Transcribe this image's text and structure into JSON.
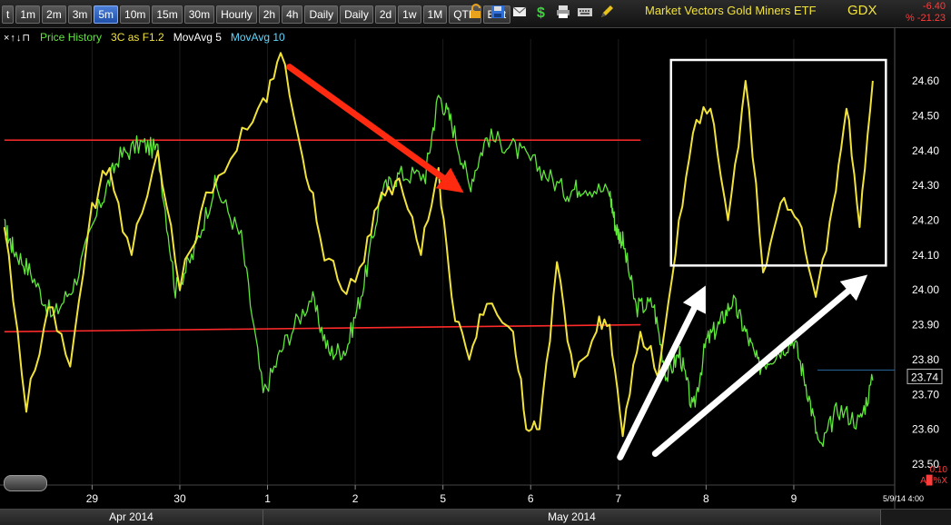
{
  "toolbar": {
    "timeframes": [
      "t",
      "1m",
      "2m",
      "3m",
      "5m",
      "10m",
      "15m",
      "30m",
      "Hourly",
      "2h",
      "4h",
      "Daily",
      "Daily",
      "2d",
      "1w",
      "1M",
      "QTR",
      "Edit"
    ],
    "active_index": 4,
    "security_name": "Market Vectors Gold Miners ETF",
    "symbol": "GDX",
    "change_abs": "-6.40",
    "change_pct": "% -21.23",
    "icons": [
      "lock-icon",
      "save-icon",
      "mail-icon",
      "dollar-icon",
      "print-icon",
      "keyboard-icon",
      "pencil-icon"
    ]
  },
  "legend": {
    "arrows": "×↑↓⊓",
    "price_history": "Price History",
    "indicator": "3C as F1.2",
    "ma5": "MovAvg 5",
    "ma10": "MovAvg 10"
  },
  "axis_corner": {
    "top": "0.10",
    "bottom": "A▉%X"
  },
  "last_date": "5/9/14 4:00",
  "months": [
    {
      "label": "Apr 2014"
    },
    {
      "label": "May 2014"
    }
  ],
  "colors": {
    "price": "#5fe83a",
    "indicator": "#f2e33b",
    "trendline": "#ff2a2a",
    "annot": "#ffffff",
    "arrow_red": "#ff2a10"
  },
  "chart_data": {
    "type": "line",
    "title": "",
    "xlabel": "",
    "ylabel": "",
    "ylim": [
      23.44,
      24.72
    ],
    "yticks": [
      24.6,
      24.5,
      24.4,
      24.3,
      24.2,
      24.1,
      24.0,
      23.9,
      23.8,
      23.7,
      23.6,
      23.5
    ],
    "ytick_labels": [
      "24.60",
      "24.50",
      "24.40",
      "24.30",
      "24.20",
      "24.10",
      "24.00",
      "23.90",
      "23.80",
      "23.70",
      "23.60",
      "23.50"
    ],
    "last_price": "23.74",
    "day_ticks": [
      {
        "label": "29",
        "i": 1.0
      },
      {
        "label": "30",
        "i": 2.0
      },
      {
        "label": "1",
        "i": 3.0
      },
      {
        "label": "2",
        "i": 4.0
      },
      {
        "label": "5",
        "i": 5.0
      },
      {
        "label": "6",
        "i": 6.0
      },
      {
        "label": "7",
        "i": 7.0
      },
      {
        "label": "8",
        "i": 8.0
      },
      {
        "label": "9",
        "i": 9.0
      }
    ],
    "series": [
      {
        "name": "Price History",
        "color": "green",
        "points": [
          [
            0.0,
            24.18
          ],
          [
            0.1,
            24.12
          ],
          [
            0.3,
            24.05
          ],
          [
            0.55,
            23.92
          ],
          [
            0.8,
            24.02
          ],
          [
            1.1,
            24.25
          ],
          [
            1.3,
            24.38
          ],
          [
            1.55,
            24.42
          ],
          [
            1.75,
            24.4
          ],
          [
            1.95,
            24.0
          ],
          [
            2.15,
            24.1
          ],
          [
            2.4,
            24.3
          ],
          [
            2.7,
            24.15
          ],
          [
            2.95,
            23.7
          ],
          [
            3.2,
            23.85
          ],
          [
            3.5,
            23.98
          ],
          [
            3.7,
            23.82
          ],
          [
            3.9,
            23.83
          ],
          [
            4.1,
            24.02
          ],
          [
            4.3,
            24.28
          ],
          [
            4.5,
            24.33
          ],
          [
            4.8,
            24.33
          ],
          [
            4.95,
            24.56
          ],
          [
            5.1,
            24.48
          ],
          [
            5.3,
            24.3
          ],
          [
            5.5,
            24.44
          ],
          [
            5.8,
            24.41
          ],
          [
            6.1,
            24.35
          ],
          [
            6.4,
            24.28
          ],
          [
            6.6,
            24.3
          ],
          [
            6.9,
            24.28
          ],
          [
            6.97,
            24.18
          ],
          [
            7.05,
            24.14
          ],
          [
            7.2,
            23.95
          ],
          [
            7.4,
            23.96
          ],
          [
            7.55,
            23.75
          ],
          [
            7.7,
            23.82
          ],
          [
            7.85,
            23.65
          ],
          [
            8.0,
            23.85
          ],
          [
            8.15,
            23.9
          ],
          [
            8.3,
            23.97
          ],
          [
            8.45,
            23.88
          ],
          [
            8.6,
            23.78
          ],
          [
            8.8,
            23.82
          ],
          [
            9.0,
            23.86
          ],
          [
            9.15,
            23.72
          ],
          [
            9.3,
            23.54
          ],
          [
            9.5,
            23.66
          ],
          [
            9.75,
            23.62
          ],
          [
            9.9,
            23.74
          ]
        ]
      },
      {
        "name": "3C as F1.2",
        "color": "yellow",
        "points": [
          [
            0.0,
            24.18
          ],
          [
            0.25,
            23.65
          ],
          [
            0.5,
            23.95
          ],
          [
            0.75,
            23.78
          ],
          [
            1.0,
            24.25
          ],
          [
            1.2,
            24.35
          ],
          [
            1.45,
            24.1
          ],
          [
            1.75,
            24.4
          ],
          [
            2.0,
            24.0
          ],
          [
            2.3,
            24.28
          ],
          [
            2.65,
            24.4
          ],
          [
            2.95,
            24.55
          ],
          [
            3.15,
            24.68
          ],
          [
            3.4,
            24.38
          ],
          [
            3.6,
            24.15
          ],
          [
            3.85,
            24.0
          ],
          [
            4.1,
            24.08
          ],
          [
            4.3,
            24.28
          ],
          [
            4.5,
            24.32
          ],
          [
            4.75,
            24.1
          ],
          [
            4.95,
            24.35
          ],
          [
            5.1,
            23.98
          ],
          [
            5.3,
            23.8
          ],
          [
            5.5,
            23.96
          ],
          [
            5.8,
            23.88
          ],
          [
            5.95,
            23.6
          ],
          [
            6.1,
            23.6
          ],
          [
            6.3,
            24.08
          ],
          [
            6.5,
            23.75
          ],
          [
            6.75,
            23.88
          ],
          [
            6.9,
            23.9
          ],
          [
            7.05,
            23.58
          ],
          [
            7.25,
            23.88
          ],
          [
            7.45,
            23.75
          ],
          [
            7.65,
            24.1
          ],
          [
            7.85,
            24.45
          ],
          [
            8.05,
            24.52
          ],
          [
            8.25,
            24.2
          ],
          [
            8.45,
            24.6
          ],
          [
            8.65,
            24.05
          ],
          [
            8.85,
            24.25
          ],
          [
            9.05,
            24.2
          ],
          [
            9.25,
            23.98
          ],
          [
            9.45,
            24.25
          ],
          [
            9.6,
            24.52
          ],
          [
            9.75,
            24.18
          ],
          [
            9.9,
            24.6
          ]
        ]
      }
    ],
    "annotations": {
      "hlines": [
        {
          "y0": 24.43,
          "y1": 24.43,
          "x0": 0.0,
          "x1": 7.25
        },
        {
          "y0": 23.88,
          "y1": 23.9,
          "x0": 0.0,
          "x1": 7.25
        }
      ],
      "box": {
        "x0": 7.6,
        "x1": 10.05,
        "y0": 24.07,
        "y1": 24.66
      },
      "red_arrow": {
        "from": [
          3.25,
          24.64
        ],
        "to": [
          5.12,
          24.3
        ]
      },
      "white_arrows": [
        {
          "from": [
            7.02,
            23.52
          ],
          "to": [
            7.93,
            23.98
          ]
        },
        {
          "from": [
            7.42,
            23.53
          ],
          "to": [
            9.73,
            24.02
          ]
        }
      ]
    }
  }
}
